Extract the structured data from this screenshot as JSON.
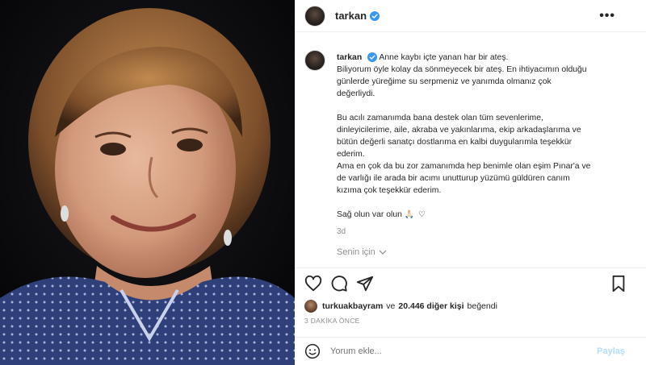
{
  "header": {
    "username": "tarkan",
    "verified_color": "#3897f0",
    "more_icon": "more-horizontal-icon"
  },
  "caption": {
    "username": "tarkan",
    "line1": "Anne kaybı içte yanan har bir ateş.",
    "line2": "Biliyorum öyle kolay da sönmeyecek bir ateş. En ihtiyacımın olduğu",
    "line3": "günlerde yüreğime su serpmeniz ve yanımda olmanız çok",
    "line4": "değerliydi.",
    "line5": "Bu acılı zamanımda bana destek olan tüm sevenlerime,",
    "line6": "dinleyicilerime, aile, akraba ve yakınlarıma, ekip arkadaşlarıma ve",
    "line7": "bütün değerli sanatçı dostlarıma en kalbi duygularımla teşekkür",
    "line8": "ederim.",
    "line9": "Ama en çok da bu zor zamanımda hep benimle olan eşim Pınar'a ve",
    "line10": "de varlığı ile arada bir acımı unutturup yüzümü güldüren canım",
    "line11": "kızıma çok teşekkür ederim.",
    "line12": "Sağ olun var olun",
    "hearts": "🙏🏻 ♡",
    "time": "3d"
  },
  "translation": {
    "label": "Senin için"
  },
  "actions": {
    "like_icon": "heart-icon",
    "comment_icon": "comment-icon",
    "share_icon": "share-icon",
    "save_icon": "bookmark-icon"
  },
  "likes": {
    "user": "turkuakbayram",
    "connector": "ve",
    "count": "20.446 diğer kişi",
    "suffix": "beğendi"
  },
  "timeago": "3 DAKİKA ÖNCE",
  "comment": {
    "placeholder": "Yorum ekle...",
    "post_label": "Paylaş"
  }
}
